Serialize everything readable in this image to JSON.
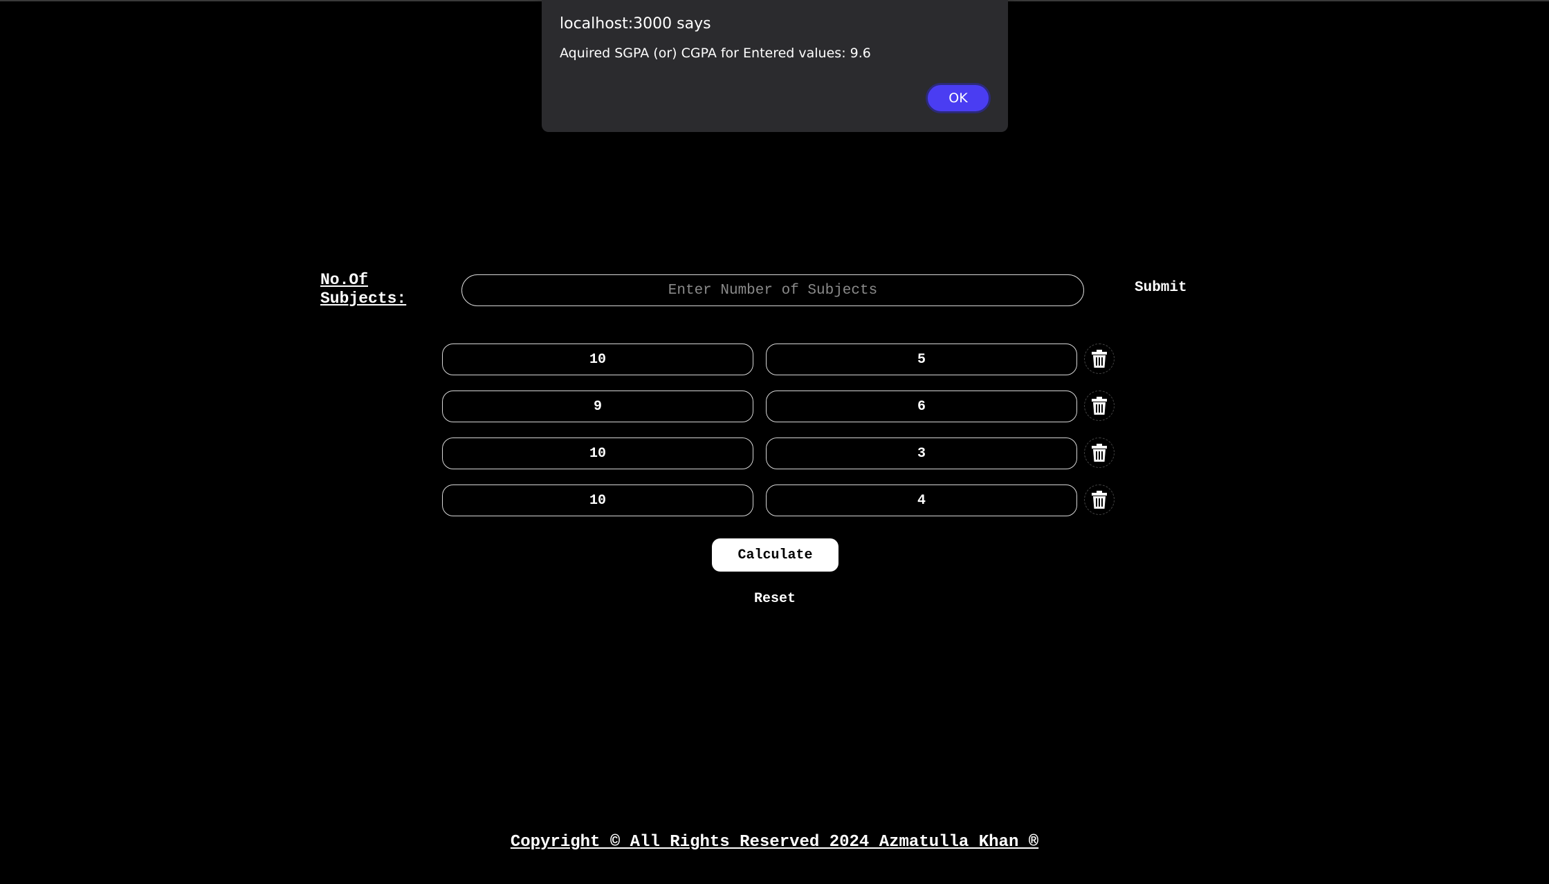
{
  "alert": {
    "title": "localhost:3000 says",
    "message": "Aquired SGPA (or) CGPA for Entered values: 9.6",
    "ok_label": "OK"
  },
  "subjects": {
    "label": "No.Of Subjects:",
    "placeholder": "Enter Number of Subjects",
    "value": "",
    "submit_label": "Submit"
  },
  "rows": [
    {
      "grade": "10",
      "credits": "5"
    },
    {
      "grade": "9",
      "credits": "6"
    },
    {
      "grade": "10",
      "credits": "3"
    },
    {
      "grade": "10",
      "credits": "4"
    }
  ],
  "actions": {
    "calculate_label": "Calculate",
    "reset_label": "Reset"
  },
  "footer": {
    "text": "Copyright © All Rights Reserved 2024 Azmatulla Khan ®"
  },
  "icons": {
    "delete": "trash-icon"
  },
  "colors": {
    "background": "#000000",
    "dialog_bg": "#2b2b2e",
    "ok_button": "#4a3df2"
  }
}
